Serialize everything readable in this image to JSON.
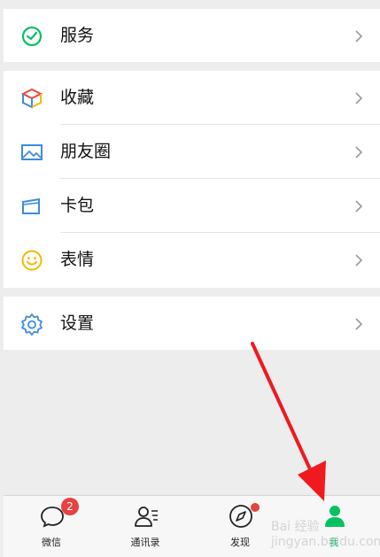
{
  "menu": {
    "service": {
      "label": "服务",
      "icon": "service-icon"
    },
    "favorites": {
      "label": "收藏",
      "icon": "favorites-cube-icon"
    },
    "moments": {
      "label": "朋友圈",
      "icon": "image-icon"
    },
    "cards": {
      "label": "卡包",
      "icon": "card-wallet-icon"
    },
    "stickers": {
      "label": "表情",
      "icon": "smiley-icon"
    },
    "settings": {
      "label": "设置",
      "icon": "gear-icon"
    }
  },
  "tabs": {
    "chats": {
      "label": "微信",
      "badge": "2",
      "icon": "chat-bubble-icon"
    },
    "contacts": {
      "label": "通讯录",
      "icon": "contacts-icon"
    },
    "discover": {
      "label": "发现",
      "icon": "compass-icon",
      "has_dot": true
    },
    "me": {
      "label": "我",
      "icon": "person-icon",
      "active": true
    }
  },
  "watermark": "Bai 经验 jingyan.baidu.com",
  "colors": {
    "accent": "#07c160",
    "badge": "#e64340",
    "arrow": "#f0191e",
    "background": "#ededed"
  }
}
